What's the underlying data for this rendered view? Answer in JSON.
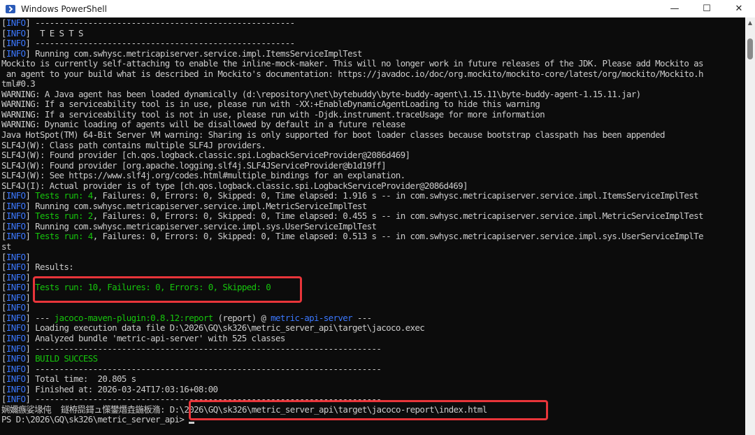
{
  "window": {
    "title": "Windows PowerShell",
    "controls": {
      "minimize": "—",
      "maximize": "☐",
      "close": "✕"
    }
  },
  "colors": {
    "blue": "#3b78ff",
    "green": "#16c60c",
    "highlight": "#e8353a"
  },
  "console": {
    "lines": [
      [
        {
          "t": "[",
          "c": ""
        },
        {
          "t": "INFO",
          "c": "blue"
        },
        {
          "t": "] ------------------------------------------------------",
          "c": ""
        }
      ],
      [
        {
          "t": "[",
          "c": ""
        },
        {
          "t": "INFO",
          "c": "blue"
        },
        {
          "t": "]  T E S T S",
          "c": ""
        }
      ],
      [
        {
          "t": "[",
          "c": ""
        },
        {
          "t": "INFO",
          "c": "blue"
        },
        {
          "t": "] ------------------------------------------------------",
          "c": ""
        }
      ],
      [
        {
          "t": "[",
          "c": ""
        },
        {
          "t": "INFO",
          "c": "blue"
        },
        {
          "t": "] Running com.swhysc.metricapiserver.service.impl.ItemsServiceImplTest",
          "c": ""
        }
      ],
      [
        {
          "t": "Mockito is currently self-attaching to enable the inline-mock-maker. This will no longer work in future releases of the JDK. Please add Mockito as",
          "c": ""
        }
      ],
      [
        {
          "t": " an agent to your build what is described in Mockito's documentation: https://javadoc.io/doc/org.mockito/mockito-core/latest/org/mockito/Mockito.h",
          "c": ""
        }
      ],
      [
        {
          "t": "tml#0.3",
          "c": ""
        }
      ],
      [
        {
          "t": "WARNING: A Java agent has been loaded dynamically (d:\\repository\\net\\bytebuddy\\byte-buddy-agent\\1.15.11\\byte-buddy-agent-1.15.11.jar)",
          "c": ""
        }
      ],
      [
        {
          "t": "WARNING: If a serviceability tool is in use, please run with -XX:+EnableDynamicAgentLoading to hide this warning",
          "c": ""
        }
      ],
      [
        {
          "t": "WARNING: If a serviceability tool is not in use, please run with -Djdk.instrument.traceUsage for more information",
          "c": ""
        }
      ],
      [
        {
          "t": "WARNING: Dynamic loading of agents will be disallowed by default in a future release",
          "c": ""
        }
      ],
      [
        {
          "t": "Java HotSpot(TM) 64-Bit Server VM warning: Sharing is only supported for boot loader classes because bootstrap classpath has been appended",
          "c": ""
        }
      ],
      [
        {
          "t": "SLF4J(W): Class path contains multiple SLF4J providers.",
          "c": ""
        }
      ],
      [
        {
          "t": "SLF4J(W): Found provider [ch.qos.logback.classic.spi.LogbackServiceProvider@2086d469]",
          "c": ""
        }
      ],
      [
        {
          "t": "SLF4J(W): Found provider [org.apache.logging.slf4j.SLF4JServiceProvider@b1d19ff]",
          "c": ""
        }
      ],
      [
        {
          "t": "SLF4J(W): See https://www.slf4j.org/codes.html#multiple_bindings for an explanation.",
          "c": ""
        }
      ],
      [
        {
          "t": "SLF4J(I): Actual provider is of type [ch.qos.logback.classic.spi.LogbackServiceProvider@2086d469]",
          "c": ""
        }
      ],
      [
        {
          "t": "[",
          "c": ""
        },
        {
          "t": "INFO",
          "c": "blue"
        },
        {
          "t": "] ",
          "c": ""
        },
        {
          "t": "Tests run: 4",
          "c": "green"
        },
        {
          "t": ", Failures: 0, Errors: 0, Skipped: 0, Time elapsed: 1.916 s -- in com.swhysc.metricapiserver.service.impl.ItemsServiceImplTest",
          "c": ""
        }
      ],
      [
        {
          "t": "[",
          "c": ""
        },
        {
          "t": "INFO",
          "c": "blue"
        },
        {
          "t": "] Running com.swhysc.metricapiserver.service.impl.MetricServiceImplTest",
          "c": ""
        }
      ],
      [
        {
          "t": "[",
          "c": ""
        },
        {
          "t": "INFO",
          "c": "blue"
        },
        {
          "t": "] ",
          "c": ""
        },
        {
          "t": "Tests run: 2",
          "c": "green"
        },
        {
          "t": ", Failures: 0, Errors: 0, Skipped: 0, Time elapsed: 0.455 s -- in com.swhysc.metricapiserver.service.impl.MetricServiceImplTest",
          "c": ""
        }
      ],
      [
        {
          "t": "[",
          "c": ""
        },
        {
          "t": "INFO",
          "c": "blue"
        },
        {
          "t": "] Running com.swhysc.metricapiserver.service.impl.sys.UserServiceImplTest",
          "c": ""
        }
      ],
      [
        {
          "t": "[",
          "c": ""
        },
        {
          "t": "INFO",
          "c": "blue"
        },
        {
          "t": "] ",
          "c": ""
        },
        {
          "t": "Tests run: 4",
          "c": "green"
        },
        {
          "t": ", Failures: 0, Errors: 0, Skipped: 0, Time elapsed: 0.513 s -- in com.swhysc.metricapiserver.service.impl.sys.UserServiceImplTe",
          "c": ""
        }
      ],
      [
        {
          "t": "st",
          "c": ""
        }
      ],
      [
        {
          "t": "[",
          "c": ""
        },
        {
          "t": "INFO",
          "c": "blue"
        },
        {
          "t": "]",
          "c": ""
        }
      ],
      [
        {
          "t": "[",
          "c": ""
        },
        {
          "t": "INFO",
          "c": "blue"
        },
        {
          "t": "] Results:",
          "c": ""
        }
      ],
      [
        {
          "t": "[",
          "c": ""
        },
        {
          "t": "INFO",
          "c": "blue"
        },
        {
          "t": "]",
          "c": ""
        }
      ],
      [
        {
          "t": "[",
          "c": ""
        },
        {
          "t": "INFO",
          "c": "blue"
        },
        {
          "t": "] ",
          "c": ""
        },
        {
          "t": "Tests run: 10, Failures: 0, Errors: 0, Skipped: 0",
          "c": "green"
        }
      ],
      [
        {
          "t": "[",
          "c": ""
        },
        {
          "t": "INFO",
          "c": "blue"
        },
        {
          "t": "]",
          "c": ""
        }
      ],
      [
        {
          "t": "[",
          "c": ""
        },
        {
          "t": "INFO",
          "c": "blue"
        },
        {
          "t": "]",
          "c": ""
        }
      ],
      [
        {
          "t": "[",
          "c": ""
        },
        {
          "t": "INFO",
          "c": "blue"
        },
        {
          "t": "] --- ",
          "c": ""
        },
        {
          "t": "jacoco-maven-plugin:0.8.12:report",
          "c": "green"
        },
        {
          "t": " (report) @ ",
          "c": ""
        },
        {
          "t": "metric-api-server",
          "c": "blue"
        },
        {
          "t": " ---",
          "c": ""
        }
      ],
      [
        {
          "t": "[",
          "c": ""
        },
        {
          "t": "INFO",
          "c": "blue"
        },
        {
          "t": "] Loading execution data file D:\\2026\\GQ\\sk326\\metric_server_api\\target\\jacoco.exec",
          "c": ""
        }
      ],
      [
        {
          "t": "[",
          "c": ""
        },
        {
          "t": "INFO",
          "c": "blue"
        },
        {
          "t": "] Analyzed bundle 'metric-api-server' with 525 classes",
          "c": ""
        }
      ],
      [
        {
          "t": "[",
          "c": ""
        },
        {
          "t": "INFO",
          "c": "blue"
        },
        {
          "t": "] ------------------------------------------------------------------------",
          "c": ""
        }
      ],
      [
        {
          "t": "[",
          "c": ""
        },
        {
          "t": "INFO",
          "c": "blue"
        },
        {
          "t": "] ",
          "c": ""
        },
        {
          "t": "BUILD SUCCESS",
          "c": "green"
        }
      ],
      [
        {
          "t": "[",
          "c": ""
        },
        {
          "t": "INFO",
          "c": "blue"
        },
        {
          "t": "] ------------------------------------------------------------------------",
          "c": ""
        }
      ],
      [
        {
          "t": "[",
          "c": ""
        },
        {
          "t": "INFO",
          "c": "blue"
        },
        {
          "t": "] Total time:  20.805 s",
          "c": ""
        }
      ],
      [
        {
          "t": "[",
          "c": ""
        },
        {
          "t": "INFO",
          "c": "blue"
        },
        {
          "t": "] Finished at: 2026-03-24T17:03:16+08:00",
          "c": ""
        }
      ],
      [
        {
          "t": "[",
          "c": ""
        },
        {
          "t": "INFO",
          "c": "blue"
        },
        {
          "t": "] ------------------------------------------------------------------------",
          "c": ""
        }
      ],
      [
        {
          "t": "娴嬭瘯娑堟伅  鐩栫巼鎶ュ憡鐢熸垚鍦板潃: D:\\2026\\GQ\\sk326\\metric_server_api\\target\\jacoco-report\\index.html",
          "c": ""
        }
      ],
      [
        {
          "t": "PS D:\\2026\\GQ\\sk326\\metric_server_api> ",
          "c": ""
        }
      ]
    ]
  }
}
